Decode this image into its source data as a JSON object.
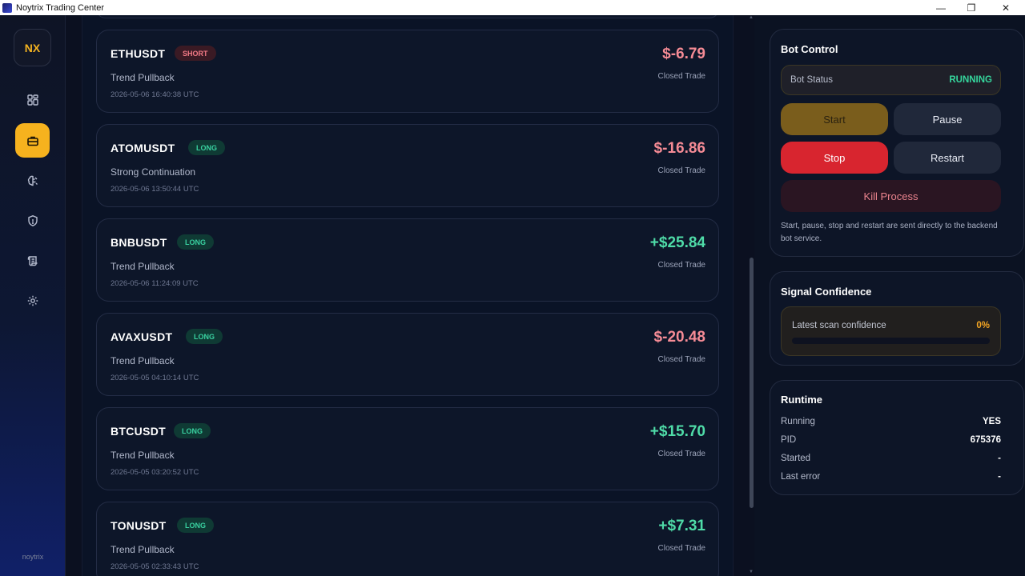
{
  "window": {
    "title": "Noytrix Trading Center",
    "controls": [
      "—",
      "❐",
      "✕"
    ]
  },
  "sidebar": {
    "logo": "NX",
    "items": [
      {
        "name": "dashboard",
        "icon": "grid-icon",
        "active": false
      },
      {
        "name": "trades",
        "icon": "briefcase-icon",
        "active": true
      },
      {
        "name": "strategy",
        "icon": "brain-icon",
        "active": false
      },
      {
        "name": "security",
        "icon": "shield-icon",
        "active": false
      },
      {
        "name": "logs",
        "icon": "scroll-icon",
        "active": false
      },
      {
        "name": "settings",
        "icon": "gear-icon",
        "active": false
      }
    ],
    "footer": "noytrix"
  },
  "trades": [
    {
      "symbol": "ETHUSDT",
      "side": "SHORT",
      "strategy": "Trend Pullback",
      "time": "2026-05-06 16:40:38 UTC",
      "pnl": "$-6.79",
      "status": "Closed Trade"
    },
    {
      "symbol": "ATOMUSDT",
      "side": "LONG",
      "strategy": "Strong Continuation",
      "time": "2026-05-06 13:50:44 UTC",
      "pnl": "$-16.86",
      "status": "Closed Trade"
    },
    {
      "symbol": "BNBUSDT",
      "side": "LONG",
      "strategy": "Trend Pullback",
      "time": "2026-05-06 11:24:09 UTC",
      "pnl": "+$25.84",
      "status": "Closed Trade"
    },
    {
      "symbol": "AVAXUSDT",
      "side": "LONG",
      "strategy": "Trend Pullback",
      "time": "2026-05-05 04:10:14 UTC",
      "pnl": "$-20.48",
      "status": "Closed Trade"
    },
    {
      "symbol": "BTCUSDT",
      "side": "LONG",
      "strategy": "Trend Pullback",
      "time": "2026-05-05 03:20:52 UTC",
      "pnl": "+$15.70",
      "status": "Closed Trade"
    },
    {
      "symbol": "TONUSDT",
      "side": "LONG",
      "strategy": "Trend Pullback",
      "time": "2026-05-05 02:33:43 UTC",
      "pnl": "+$7.31",
      "status": "Closed Trade"
    }
  ],
  "bot_control": {
    "title": "Bot Control",
    "status_label": "Bot Status",
    "status_value": "RUNNING",
    "buttons": {
      "start": "Start",
      "pause": "Pause",
      "stop": "Stop",
      "restart": "Restart",
      "kill": "Kill Process"
    },
    "note": "Start, pause, stop and restart are sent directly to the backend bot service."
  },
  "signal_confidence": {
    "title": "Signal Confidence",
    "label": "Latest scan confidence",
    "value": "0%",
    "fraction": 0
  },
  "runtime": {
    "title": "Runtime",
    "rows": [
      {
        "key": "Running",
        "value": "YES"
      },
      {
        "key": "PID",
        "value": "675376"
      },
      {
        "key": "Started",
        "value": "-"
      },
      {
        "key": "Last error",
        "value": "-"
      }
    ]
  },
  "colors": {
    "accent": "#f6b21e",
    "positive": "#4fdca8",
    "negative": "#f58b95",
    "stop": "#d8252f"
  }
}
